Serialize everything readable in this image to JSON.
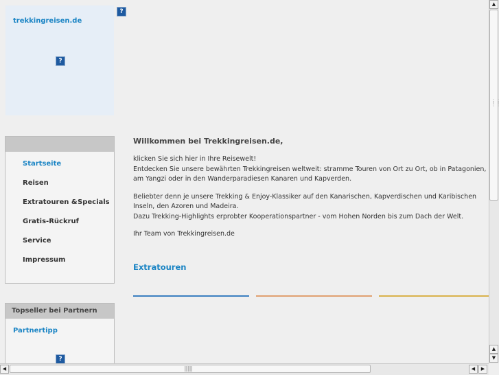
{
  "logo": {
    "site_name": "trekkingreisen.de"
  },
  "nav": {
    "items": [
      {
        "label": "Startseite",
        "active": true
      },
      {
        "label": "Reisen"
      },
      {
        "label": "Extratouren &",
        "label2": "Specials"
      },
      {
        "label": "Gratis-Rückruf"
      },
      {
        "label": "Service"
      },
      {
        "label": "Impressum"
      }
    ]
  },
  "partner": {
    "title": "Topseller bei Partnern",
    "link": "Partnertipp"
  },
  "main": {
    "heading": "Willkommen bei Trekkingreisen.de,",
    "p1_line1": "klicken Sie sich hier in Ihre Reisewelt!",
    "p1_line2": "Entdecken Sie unsere bewährten Trekkingreisen weltweit: stramme Touren von Ort zu Ort, ob in Patagonien, am Yangzi oder in den Wanderparadiesen Kanaren und Kapverden.",
    "p2_line1": "Beliebter denn je unsere Trekking & Enjoy-Klassiker auf den Kanarischen, Kapverdischen und Karibischen Inseln, den Azoren und Madeira.",
    "p2_line2": "Dazu Trekking-Highlights erprobter Kooperationspartner - vom Hohen Norden bis zum Dach der Welt.",
    "p3": "Ihr Team von Trekkingreisen.de",
    "extra_title": "Extratouren"
  },
  "colors": {
    "accent": "#1a84c4",
    "line_blue": "#3b7fc0",
    "line_orange": "#e0a070",
    "line_yellow": "#d9b24a"
  },
  "icons": {
    "broken_image": "broken-image-icon",
    "scroll_up": "scroll-up-arrow",
    "scroll_down": "scroll-down-arrow",
    "scroll_left": "scroll-left-arrow",
    "scroll_right": "scroll-right-arrow"
  }
}
